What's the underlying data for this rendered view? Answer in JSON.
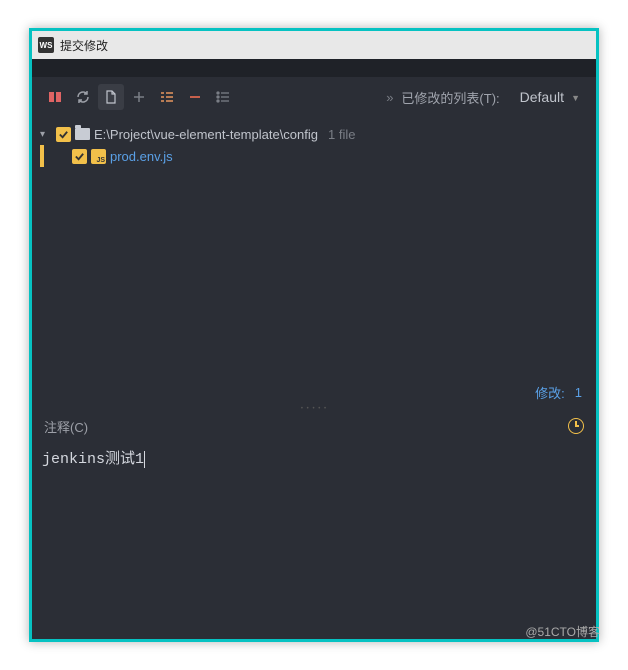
{
  "window": {
    "title": "提交修改",
    "logo": "WS"
  },
  "toolbar": {
    "changelist_label": "已修改的列表(T):",
    "changelist_value": "Default"
  },
  "tree": {
    "root": {
      "path": "E:\\Project\\vue-element-template\\config",
      "count": "1 file"
    },
    "file": "prod.env.js",
    "file_icon_text": "JS"
  },
  "status": {
    "label": "修改:",
    "count": "1"
  },
  "comment": {
    "label": "注释(C)",
    "value": "jenkins测试1"
  },
  "watermark": "@51CTO博客"
}
